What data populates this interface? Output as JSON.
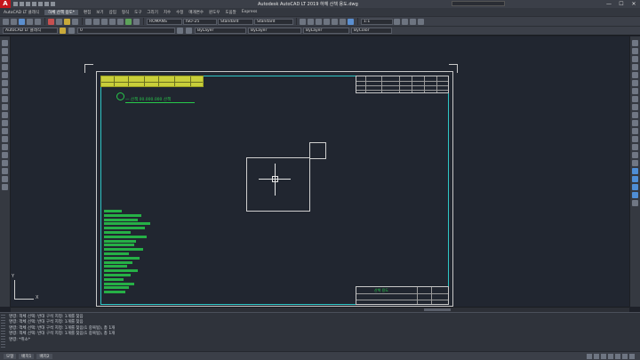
{
  "titlebar": {
    "app_logo": "A",
    "title": "Autodesk AutoCAD LT 2019    하체 산책 용도.dwg",
    "min": "—",
    "max": "☐",
    "close": "✕"
  },
  "menubar": {
    "items": [
      "AutoCAD LT 클래식",
      "편집",
      "보기",
      "삽입",
      "형식",
      "도구",
      "그리기",
      "치수",
      "수정",
      "매개변수",
      "윈도우",
      "도움말",
      "Express"
    ],
    "active_tab": "하체 산책 용도*"
  },
  "toolbar1": {
    "layer_style": "ROMANS",
    "dim_style": "ISO-25",
    "text_style": "Standard",
    "table_style": "Standard",
    "scale": "1:1"
  },
  "toolbar2": {
    "workspace": "AutoCAD LT 클래식",
    "layer": "0",
    "color": "ByLayer",
    "linetype": "ByLayer",
    "lineweight": "ByLayer",
    "plotstyle": "ByColor"
  },
  "drawing": {
    "stamp_text": "— 산책 00.000.000 산책"
  },
  "bottom_title": {
    "label": "산책 용도"
  },
  "ucs": {
    "x": "X",
    "y": "Y"
  },
  "command": {
    "history": [
      "명령: 객체 선택: 반대 구석 지정: 1개를 찾음",
      "명령: 객체 선택: 반대 구석 지정: 1개를 찾음",
      "명령: 객체 선택: 반대 구석 지정: 1개를 찾음(1 중복됨), 총 1개",
      "명령: 객체 선택: 반대 구석 지정: 1개를 찾음(1 중복됨), 총 1개",
      "명령: *취소*"
    ]
  },
  "status": {
    "tabs": [
      "모형",
      "배치1",
      "배치2"
    ]
  }
}
